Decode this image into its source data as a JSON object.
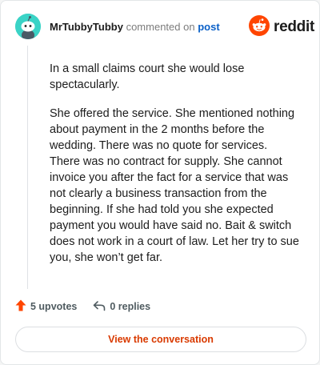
{
  "header": {
    "username": "MrTubbyTubby",
    "action_text": "commented on",
    "post_link": "post",
    "avatar_icon": "snoo-avatar-icon",
    "avatar_color": "#3ad3c6"
  },
  "brand": {
    "wordmark": "reddit",
    "logo_icon": "reddit-snoo-icon",
    "accent": "#ff4500"
  },
  "comment": {
    "paragraphs": [
      "In a small claims court she would lose spectacularly.",
      "She offered the service. She mentioned nothing about payment in the 2 months before the wedding. There was no quote for services. There was no contract for supply. She cannot invoice you after the fact for a service that was not clearly a business transaction from the beginning. If she had told you she expected payment you would have said no. Bait & switch does not work in a court of law. Let her try to sue you, she won’t get far."
    ]
  },
  "actions": {
    "upvotes": "5 upvotes",
    "upvote_icon": "upvote-arrow-icon",
    "replies": "0 replies",
    "reply_icon": "reply-arrow-icon"
  },
  "cta": {
    "label": "View the conversation",
    "color": "#d93a00"
  }
}
